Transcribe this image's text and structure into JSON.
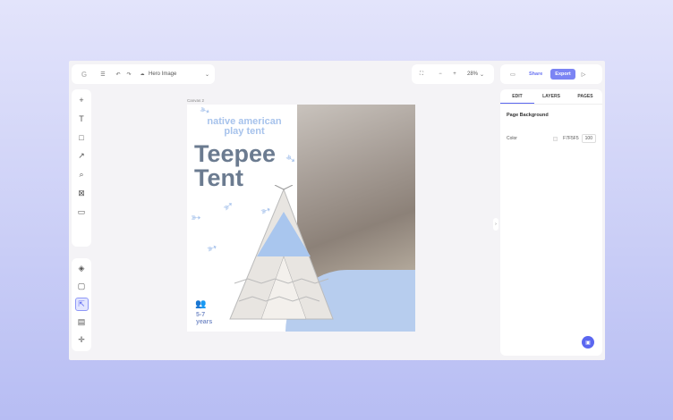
{
  "topbar": {
    "logo": "G",
    "doc_title": "Hero Image",
    "zoom": "28%",
    "share_label": "Share",
    "export_label": "Export"
  },
  "canvas": {
    "label": "Canvas 2",
    "headline_small_line1": "native american",
    "headline_small_line2": "play tent",
    "headline_big_line1": "Teepee",
    "headline_big_line2": "Tent",
    "age_line1": "5-7",
    "age_line2": "years"
  },
  "rightpanel": {
    "tabs": [
      "EDIT",
      "LAYERS",
      "PAGES"
    ],
    "section_title": "Page Background",
    "color_label": "Color",
    "color_hex": "F7F5F5",
    "opacity": "100"
  },
  "colors": {
    "accent": "#5b67f0",
    "headline_blue": "#a7c3ec",
    "headline_gray": "#6b7b90"
  }
}
